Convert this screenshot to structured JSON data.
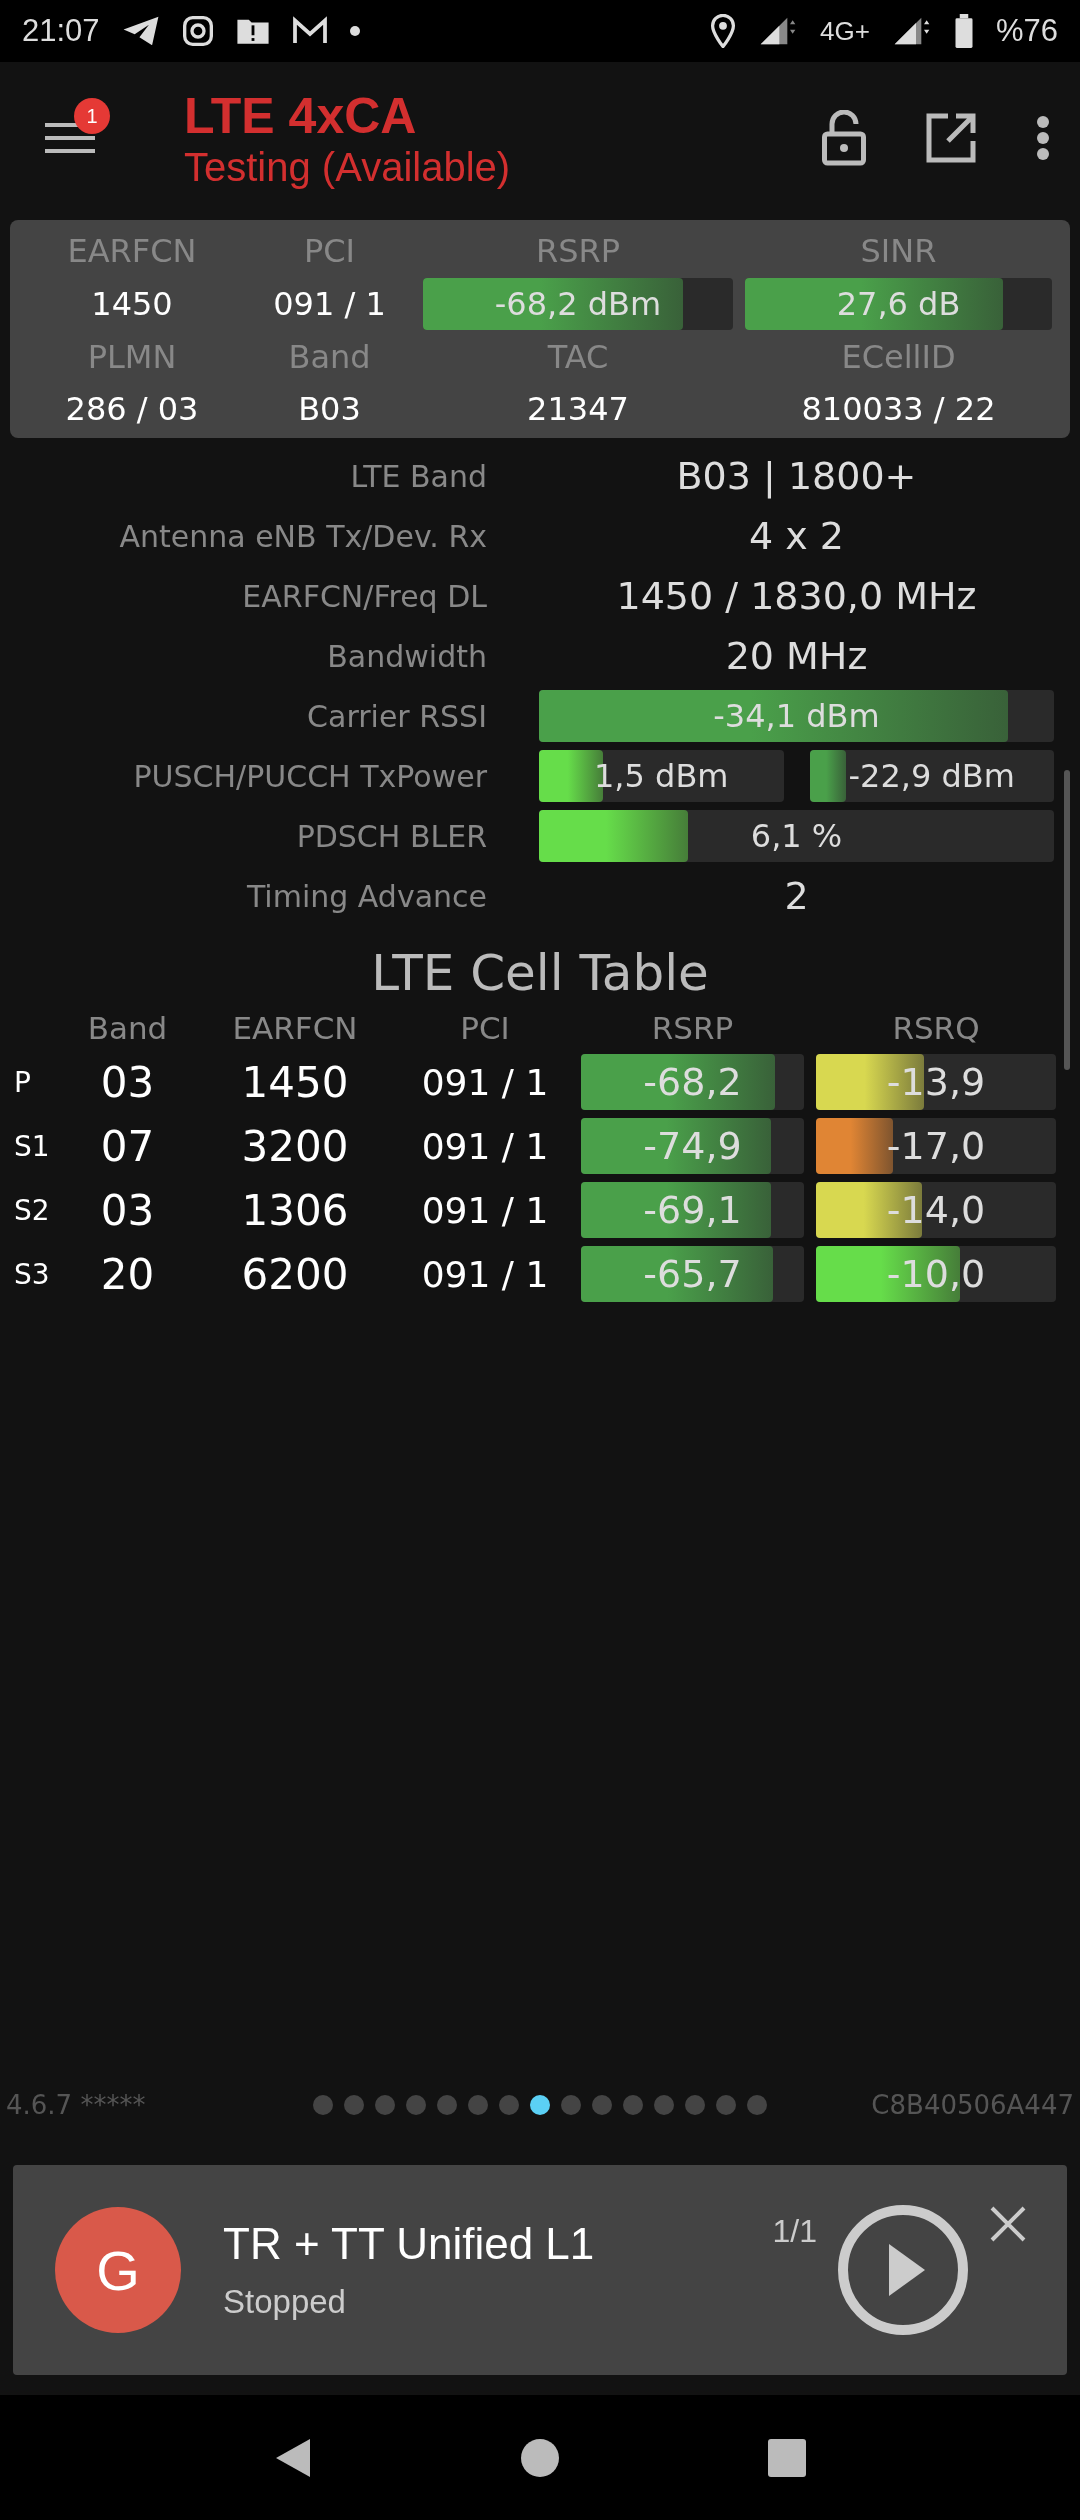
{
  "status_bar": {
    "time": "21:07",
    "network": "4G+",
    "battery": "%76"
  },
  "header": {
    "title": "LTE 4xCA",
    "subtitle": "Testing (Available)",
    "menu_badge": "1"
  },
  "summary": {
    "earfcn_label": "EARFCN",
    "pci_label": "PCI",
    "rsrp_label": "RSRP",
    "sinr_label": "SINR",
    "earfcn": "1450",
    "pci": "091 / 1",
    "rsrp": {
      "text": "-68,2 dBm",
      "level": 0.84,
      "color": "#4aa04a"
    },
    "sinr": {
      "text": "27,6 dB",
      "level": 0.84,
      "color": "#4aa04a"
    },
    "plmn_label": "PLMN",
    "band_label": "Band",
    "tac_label": "TAC",
    "ecellid_label": "ECellID",
    "plmn": "286 / 03",
    "band": "B03",
    "tac": "21347",
    "ecellid": "810033 / 22"
  },
  "details": [
    {
      "kind": "text",
      "label": "LTE Band",
      "value": "B03 | 1800+"
    },
    {
      "kind": "text",
      "label": "Antenna eNB Tx/Dev. Rx",
      "value": "4 x 2"
    },
    {
      "kind": "text",
      "label": "EARFCN/Freq DL",
      "value": "1450 / 1830,0 MHz"
    },
    {
      "kind": "text",
      "label": "Bandwidth",
      "value": "20 MHz"
    },
    {
      "kind": "bar",
      "label": "Carrier RSSI",
      "bars": [
        {
          "text": "-34,1 dBm",
          "level": 0.91,
          "color": "#4aa04a"
        }
      ]
    },
    {
      "kind": "bar",
      "label": "PUSCH/PUCCH TxPower",
      "bars": [
        {
          "text": "1,5 dBm",
          "level": 0.26,
          "color": "#66dd4a"
        },
        {
          "text": "-22,9 dBm",
          "level": 0.15,
          "color": "#4aa04a"
        }
      ]
    },
    {
      "kind": "bar",
      "label": "PDSCH BLER",
      "bars": [
        {
          "text": "6,1 %",
          "level": 0.29,
          "color": "#66dd4a"
        }
      ]
    },
    {
      "kind": "text",
      "label": "Timing Advance",
      "value": "2"
    }
  ],
  "cell_table": {
    "title": "LTE Cell Table",
    "columns": [
      "Band",
      "EARFCN",
      "PCI",
      "RSRP",
      "RSRQ"
    ],
    "rows": [
      {
        "tag": "P",
        "band": "03",
        "earfcn": "1450",
        "pci": "091 / 1",
        "rsrp": {
          "text": "-68,2",
          "level": 0.87,
          "color": "#4aa04a"
        },
        "rsrq": {
          "text": "-13,9",
          "level": 0.45,
          "color": "#d8d850"
        }
      },
      {
        "tag": "S1",
        "band": "07",
        "earfcn": "3200",
        "pci": "091 / 1",
        "rsrp": {
          "text": "-74,9",
          "level": 0.85,
          "color": "#4aa04a"
        },
        "rsrq": {
          "text": "-17,0",
          "level": 0.32,
          "color": "#e08534"
        }
      },
      {
        "tag": "S2",
        "band": "03",
        "earfcn": "1306",
        "pci": "091 / 1",
        "rsrp": {
          "text": "-69,1",
          "level": 0.85,
          "color": "#4aa04a"
        },
        "rsrq": {
          "text": "-14,0",
          "level": 0.44,
          "color": "#d8d850"
        }
      },
      {
        "tag": "S3",
        "band": "20",
        "earfcn": "6200",
        "pci": "091 / 1",
        "rsrp": {
          "text": "-65,7",
          "level": 0.86,
          "color": "#4aa04a"
        },
        "rsrq": {
          "text": "-10,0",
          "level": 0.6,
          "color": "#66dd4a"
        }
      }
    ]
  },
  "footer": {
    "version": "4.6.7 *****",
    "device_id": "C8B40506A447",
    "page_dots": [
      {
        "selected": false
      },
      {
        "selected": false
      },
      {
        "selected": false
      },
      {
        "selected": false
      },
      {
        "selected": false
      },
      {
        "selected": false
      },
      {
        "selected": false
      },
      {
        "selected": true
      },
      {
        "selected": false
      },
      {
        "selected": false
      },
      {
        "selected": false
      },
      {
        "selected": false
      },
      {
        "selected": false
      },
      {
        "selected": false
      },
      {
        "selected": false
      }
    ]
  },
  "notification": {
    "avatar": "G",
    "title": "TR + TT Unified L1",
    "status": "Stopped",
    "counter": "1/1"
  }
}
